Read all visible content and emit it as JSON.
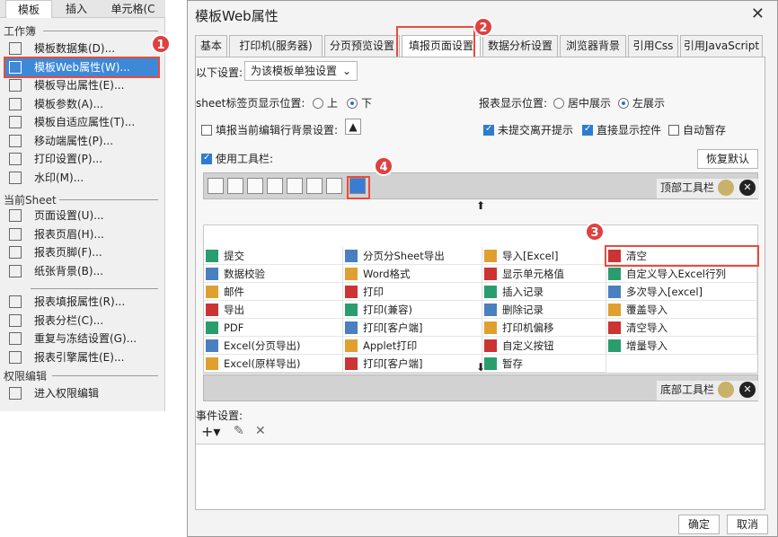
{
  "menu": {
    "tabs": [
      "模板",
      "插入",
      "单元格(C"
    ],
    "section_workbook": "工作簿",
    "items_workbook": [
      {
        "label": "模板数据集(D)...",
        "icon": "database-icon"
      },
      {
        "label": "模板Web属性(W)...",
        "icon": "globe-icon"
      },
      {
        "label": "模板导出属性(E)...",
        "icon": "export-icon"
      },
      {
        "label": "模板参数(A)...",
        "icon": "parameter-icon"
      },
      {
        "label": "模板自适应属性(T)...",
        "icon": "adaptive-icon"
      },
      {
        "label": "移动端属性(P)...",
        "icon": "mobile-icon"
      },
      {
        "label": "打印设置(P)...",
        "icon": "printer-icon"
      },
      {
        "label": "水印(M)...",
        "icon": "watermark-icon"
      }
    ],
    "section_sheet": "当前Sheet",
    "items_sheet": [
      {
        "label": "页面设置(U)...",
        "icon": "page-setup-icon"
      },
      {
        "label": "报表页眉(H)...",
        "icon": "header-icon"
      },
      {
        "label": "报表页脚(F)...",
        "icon": "footer-icon"
      },
      {
        "label": "纸张背景(B)...",
        "icon": "background-icon"
      },
      {
        "label": "报表填报属性(R)...",
        "icon": "fill-icon"
      },
      {
        "label": "报表分栏(C)...",
        "icon": "columns-icon"
      },
      {
        "label": "重复与冻结设置(G)...",
        "icon": "freeze-icon"
      },
      {
        "label": "报表引擎属性(E)...",
        "icon": "engine-icon"
      }
    ],
    "section_perm": "权限编辑",
    "items_perm": [
      {
        "label": "进入权限编辑",
        "icon": "permission-icon"
      }
    ]
  },
  "dialog": {
    "title": "模板Web属性",
    "tabs": [
      "基本",
      "打印机(服务器)",
      "分页预览设置",
      "填报页面设置",
      "数据分析设置",
      "浏览器背景",
      "引用Css",
      "引用JavaScript"
    ],
    "settings_label": "以下设置:",
    "settings_value": "为该模板单独设置",
    "sheet_pos_label": "sheet标签页显示位置:",
    "sheet_pos_top": "上",
    "sheet_pos_bottom": "下",
    "report_pos_label": "报表显示位置:",
    "report_pos_center": "居中展示",
    "report_pos_left": "左展示",
    "fill_bg_label": "填报当前编辑行背景设置:",
    "unsubmit_prompt": "未提交离开提示",
    "show_controls": "直接显示控件",
    "auto_save": "自动暂存",
    "use_toolbar": "使用工具栏:",
    "restore_default": "恢复默认",
    "top_toolbar": "顶部工具栏",
    "bottom_toolbar": "底部工具栏",
    "event_settings": "事件设置:",
    "ok": "确定",
    "cancel": "取消",
    "grid_col1": [
      "提交",
      "数据校验",
      "邮件",
      "导出",
      "PDF",
      "Excel(分页导出)",
      "Excel(原样导出)"
    ],
    "grid_col2": [
      "分页分Sheet导出",
      "Word格式",
      "打印",
      "打印(兼容)",
      "打印[客户端]",
      "Applet打印",
      "打印[客户端]"
    ],
    "grid_col3": [
      "导入[Excel]",
      "显示单元格值",
      "插入记录",
      "删除记录",
      "打印机偏移",
      "自定义按钮",
      "暂存"
    ],
    "grid_col4": [
      "清空",
      "自定义导入Excel行列",
      "多次导入[excel]",
      "覆盖导入",
      "清空导入",
      "增量导入"
    ]
  },
  "badges": [
    "1",
    "2",
    "3",
    "4"
  ]
}
